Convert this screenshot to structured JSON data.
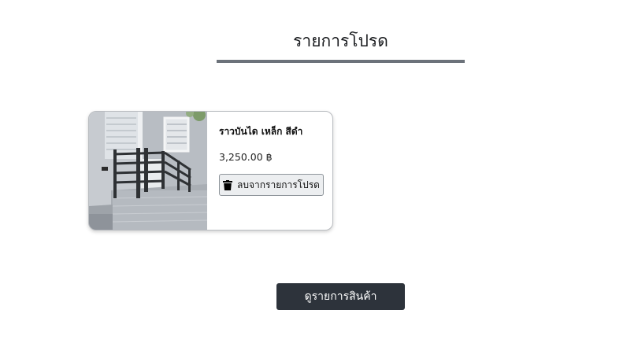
{
  "page": {
    "title": "รายการโปรด"
  },
  "favorites": [
    {
      "name": "ราวบันได เหล็ก สีดำ",
      "price": "3,250.00 ฿",
      "image_icon": "product-photo-stair-railing",
      "remove_label": "ลบจากรายการโปรด",
      "remove_icon": "trash-icon"
    }
  ],
  "actions": {
    "view_products_label": "ดูรายการสินค้า"
  },
  "colors": {
    "underline": "#6c727a",
    "primary_button": "#2d333b",
    "secondary_button": "#eceef0"
  }
}
